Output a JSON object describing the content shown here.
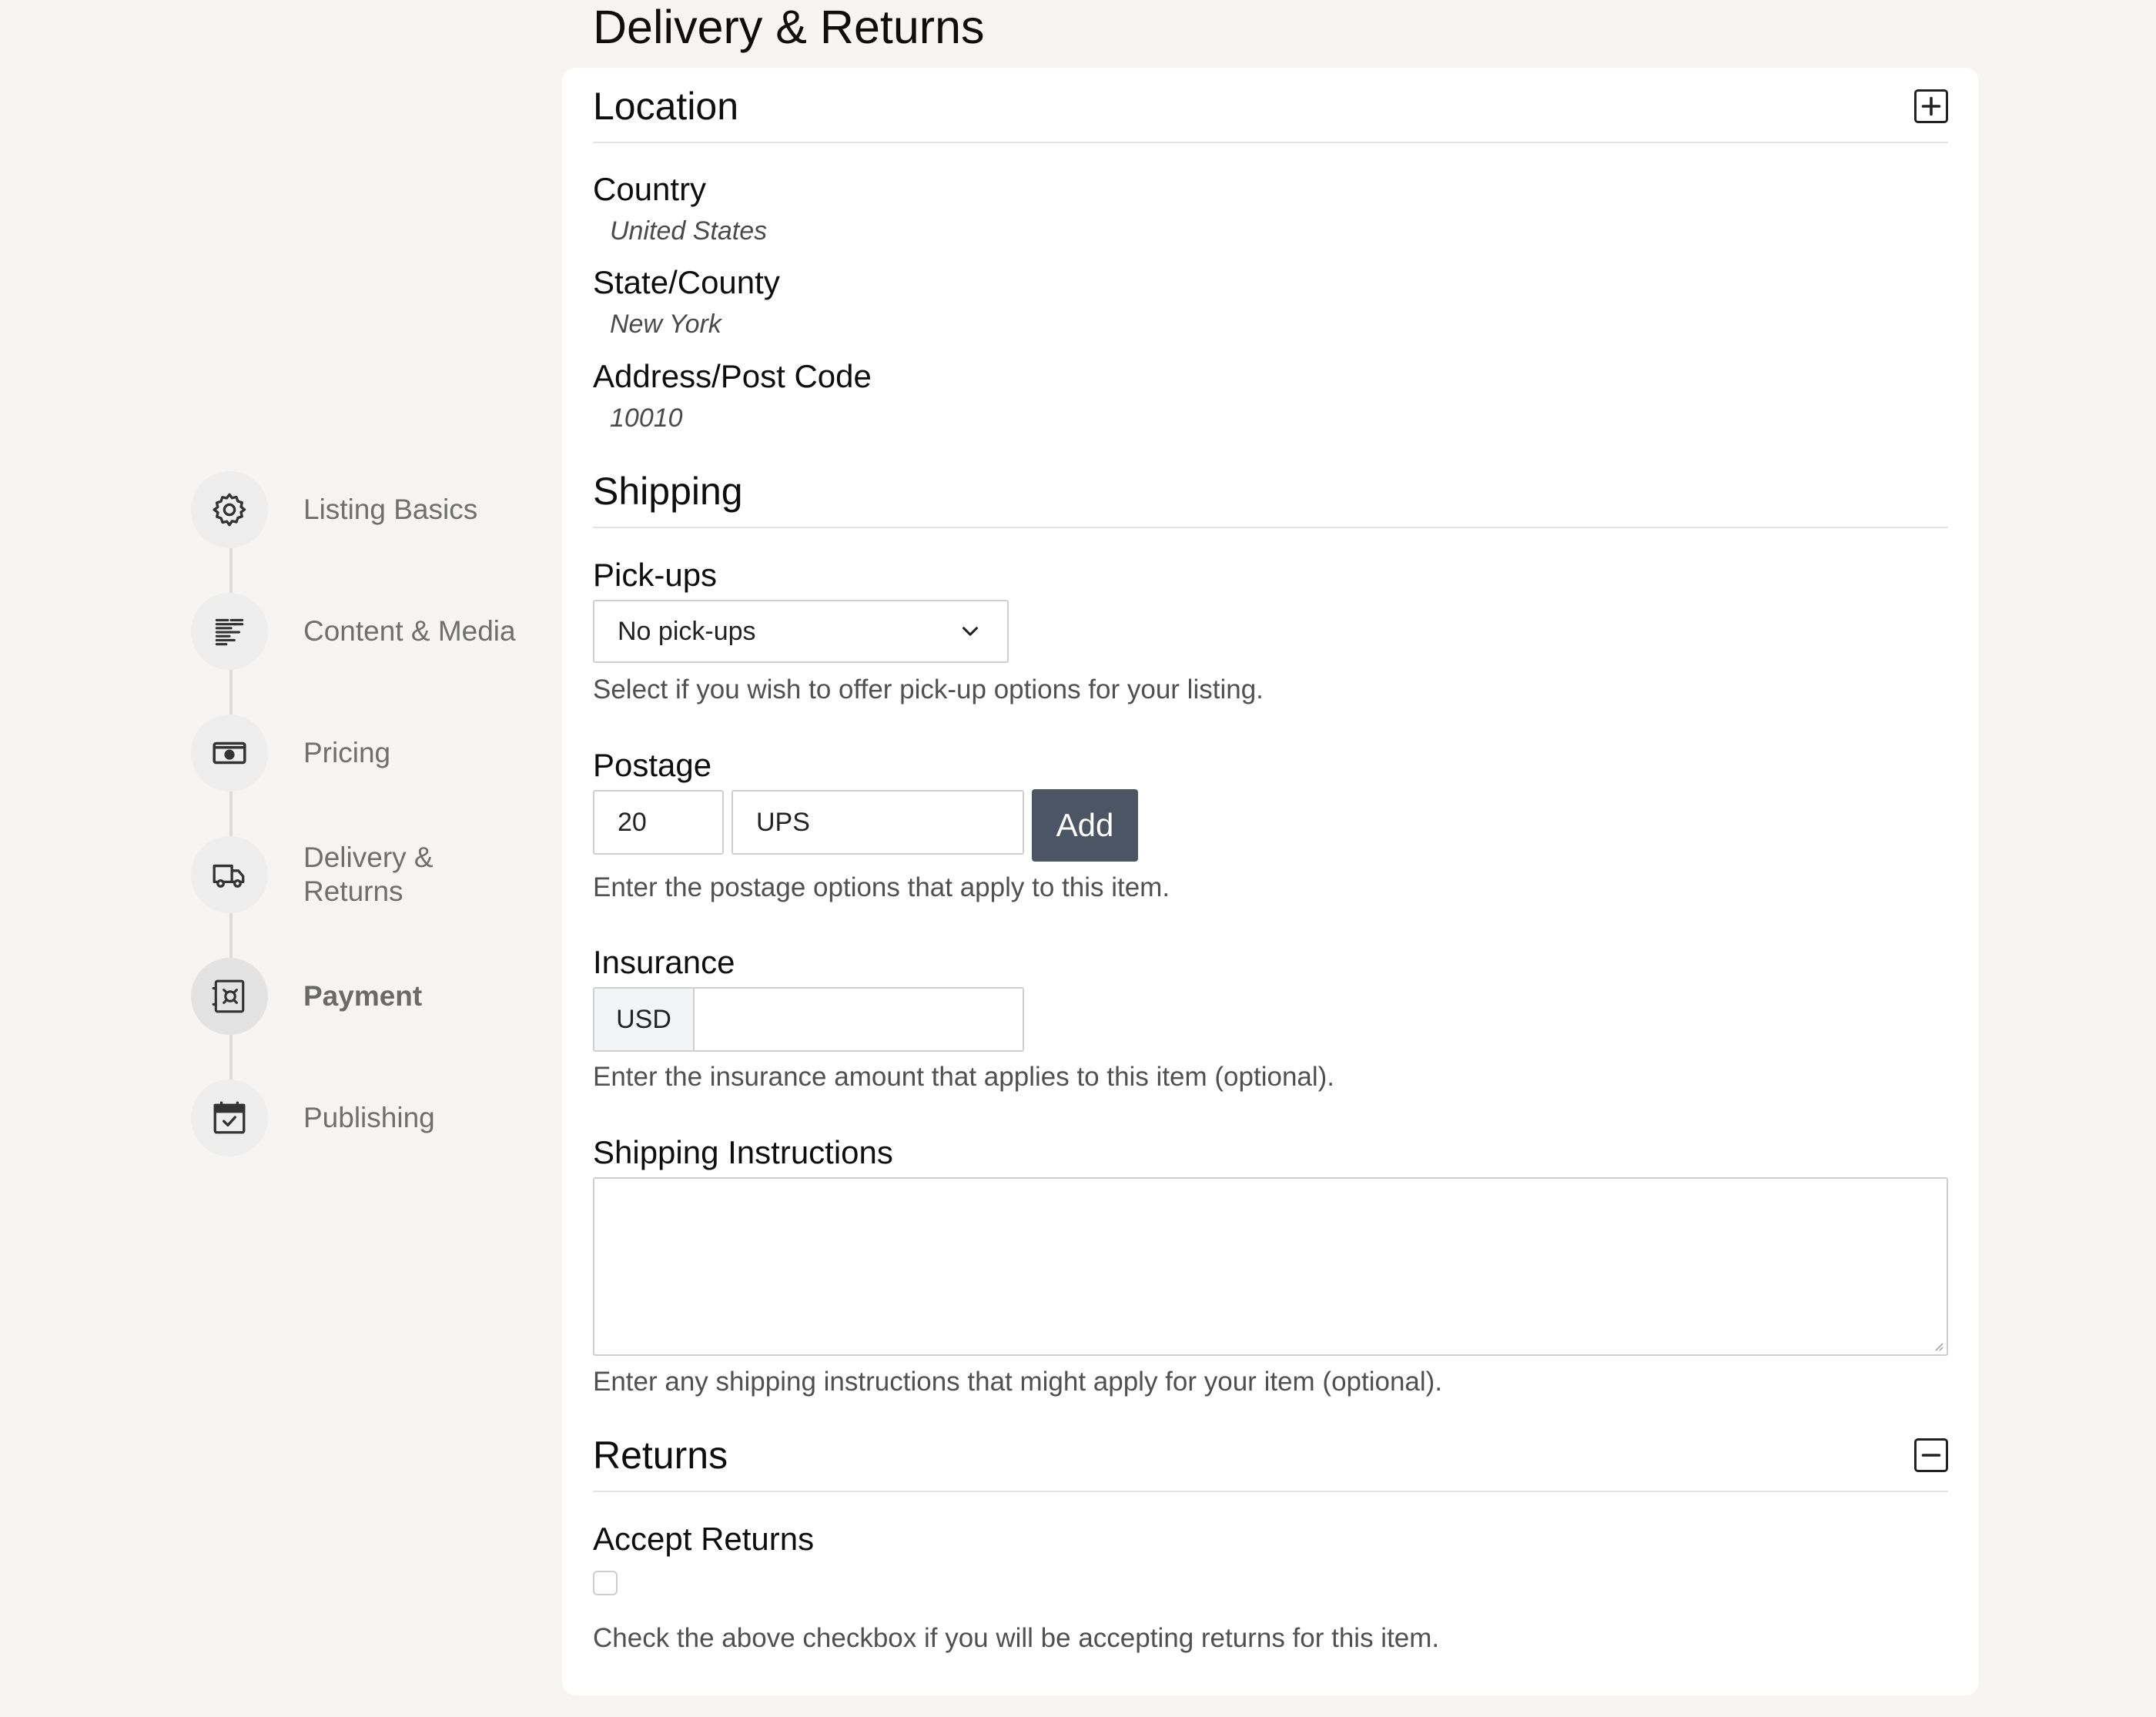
{
  "page": {
    "title": "Delivery & Returns"
  },
  "sidebar": {
    "steps": [
      {
        "label": "Listing Basics",
        "icon": "gear-icon",
        "active": false
      },
      {
        "label": "Content & Media",
        "icon": "content-media-icon",
        "active": false
      },
      {
        "label": "Pricing",
        "icon": "cash-icon",
        "active": false
      },
      {
        "label": "Delivery & Returns",
        "icon": "truck-icon",
        "active": false
      },
      {
        "label": "Payment",
        "icon": "safe-icon",
        "active": true
      },
      {
        "label": "Publishing",
        "icon": "calendar-check-icon",
        "active": false
      }
    ]
  },
  "location": {
    "title": "Location",
    "toggle_icon": "plus-square-icon",
    "country_label": "Country",
    "country_value": "United States",
    "state_label": "State/County",
    "state_value": "New York",
    "address_label": "Address/Post Code",
    "address_value": "10010"
  },
  "shipping": {
    "title": "Shipping",
    "pickups_label": "Pick-ups",
    "pickups_selected": "No pick-ups",
    "pickups_help": "Select if you wish to offer pick-up options for your listing.",
    "postage_label": "Postage",
    "postage_amount": "20",
    "postage_carrier": "UPS",
    "add_label": "Add",
    "postage_help": "Enter the postage options that apply to this item.",
    "insurance_label": "Insurance",
    "insurance_currency": "USD",
    "insurance_value": "",
    "insurance_help": "Enter the insurance amount that applies to this item (optional).",
    "instructions_label": "Shipping Instructions",
    "instructions_value": "",
    "instructions_help": "Enter any shipping instructions that might apply for your item (optional)."
  },
  "returns": {
    "title": "Returns",
    "toggle_icon": "minus-square-icon",
    "accept_label": "Accept Returns",
    "accept_checked": false,
    "accept_help": "Check the above checkbox if you will be accepting returns for this item."
  }
}
